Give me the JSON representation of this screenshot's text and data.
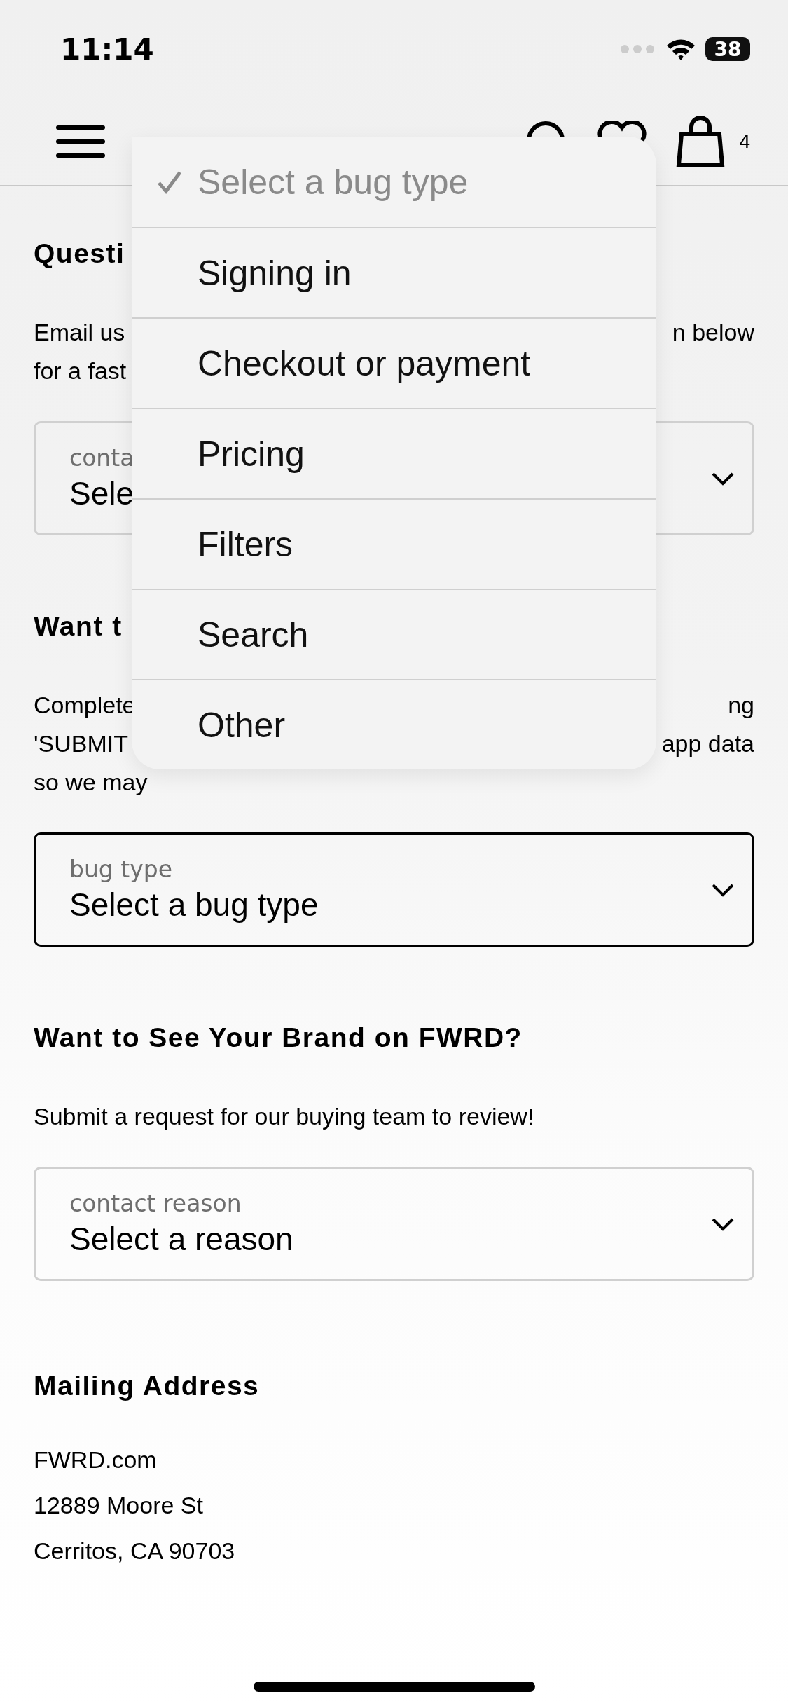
{
  "status_bar": {
    "time": "11:14",
    "battery": "38"
  },
  "nav": {
    "cart_count": "4"
  },
  "sections": [
    {
      "heading": "Questi",
      "lines": [
        {
          "left": "Email us",
          "right": "n below"
        },
        {
          "left": "for a fast"
        }
      ],
      "field": {
        "label": "conta",
        "value": "Sele",
        "active": false
      }
    },
    {
      "heading": "Want t",
      "lines": [
        {
          "left": "Complete",
          "right": "ng"
        },
        {
          "left": "'SUBMIT",
          "right": "app data"
        },
        {
          "left": "so we may"
        }
      ],
      "field": {
        "label": "bug type",
        "value": "Select a bug type",
        "active": true
      }
    },
    {
      "heading": "Want to See Your Brand on FWRD?",
      "lines": [
        {
          "left": "Submit a request for our buying team to review!"
        }
      ],
      "field": {
        "label": "contact reason",
        "value": "Select a reason",
        "active": false
      }
    }
  ],
  "mailing": {
    "heading": "Mailing Address",
    "lines": [
      "FWRD.com",
      "12889 Moore St",
      "Cerritos, CA 90703"
    ]
  },
  "dropdown": {
    "options": [
      {
        "label": "Select a bug type",
        "selected": true
      },
      {
        "label": "Signing in",
        "selected": false
      },
      {
        "label": "Checkout or payment",
        "selected": false
      },
      {
        "label": "Pricing",
        "selected": false
      },
      {
        "label": "Filters",
        "selected": false
      },
      {
        "label": "Search",
        "selected": false
      },
      {
        "label": "Other",
        "selected": false
      }
    ]
  }
}
